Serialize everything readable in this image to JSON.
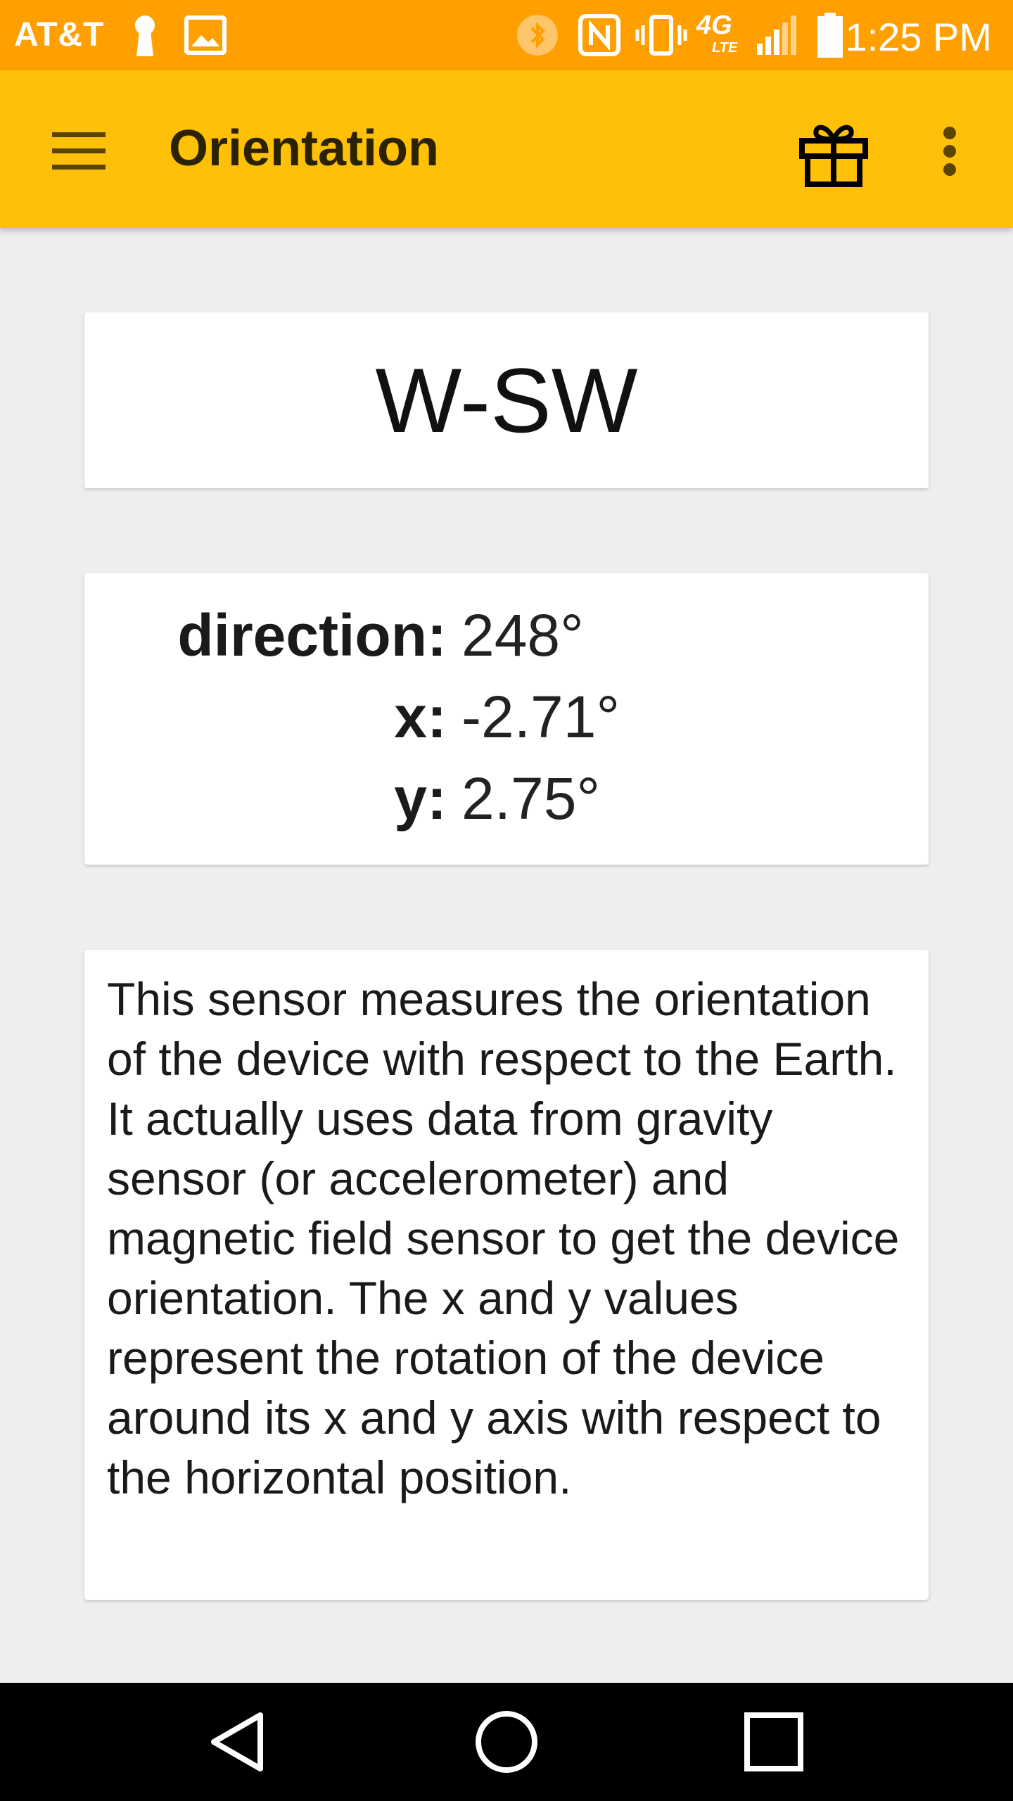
{
  "status_bar": {
    "carrier": "AT&T",
    "time": "1:25 PM",
    "network": "4G",
    "network_sub": "LTE",
    "icons": [
      "keyhole-icon",
      "image-icon",
      "bluetooth-icon",
      "nfc-icon",
      "vibrate-icon",
      "4g-lte-icon",
      "signal-icon",
      "battery-icon"
    ]
  },
  "app_bar": {
    "title": "Orientation",
    "icons": [
      "menu-icon",
      "gift-icon",
      "more-vert-icon"
    ]
  },
  "direction": {
    "cardinal": "W-SW"
  },
  "values": {
    "direction_label": "direction:",
    "direction_value": "248°",
    "x_label": "x:",
    "x_value": "-2.71°",
    "y_label": "y:",
    "y_value": "2.75°"
  },
  "description": "This sensor measures the orientation of the device with respect to the Earth. It actually uses data from gravity sensor (or accelerometer) and magnetic field sensor to get the device orientation. The x and y values represent the rotation of the device around its x and y axis with respect to the horizontal position.",
  "nav_bar": {
    "icons": [
      "back-icon",
      "home-icon",
      "recents-icon"
    ]
  },
  "colors": {
    "status_bar": "#ffa000",
    "app_bar": "#ffc107",
    "background": "#eeeeee"
  }
}
